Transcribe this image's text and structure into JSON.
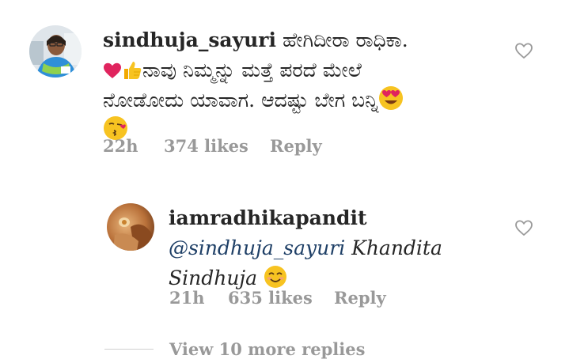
{
  "comment": {
    "username": "sindhuja_sayuri",
    "text_line1": "ಹೇಗಿದೀರಾ  ರಾಧಿಕಾ.",
    "text_line2": "ನಾವು ನಿಮ್ಮನ್ನು ಮತ್ತೆ ಪರದೆ ಮೇಲೆ",
    "text_line3": "ನೋಡೋದು ಯಾವಾಗ. ಆದಷ್ಟು ಬೇಗ ಬನ್ನಿ",
    "time": "22h",
    "likes": "374 likes",
    "reply_label": "Reply"
  },
  "reply": {
    "username": "iamradhikapandit",
    "mention": "@sindhuja_sayuri",
    "text_part1": " Khandita",
    "text_part2": "Sindhuja",
    "time": "21h",
    "likes": "635 likes",
    "reply_label": "Reply"
  },
  "view_more": "View 10 more replies",
  "icons": {
    "like": "heart-outline-icon",
    "emoji_heart": "red-heart",
    "emoji_thumbs": "thumbs-up",
    "emoji_heart_eyes": "smiling-face-with-heart-eyes",
    "emoji_kiss": "face-blowing-kiss",
    "emoji_smile": "smiling-face-with-smiling-eyes"
  },
  "colors": {
    "text": "#262626",
    "meta": "#999999",
    "mention": "#1e3f66",
    "heart_emoji": "#e0245e",
    "emoji_yellow": "#f7c321"
  }
}
